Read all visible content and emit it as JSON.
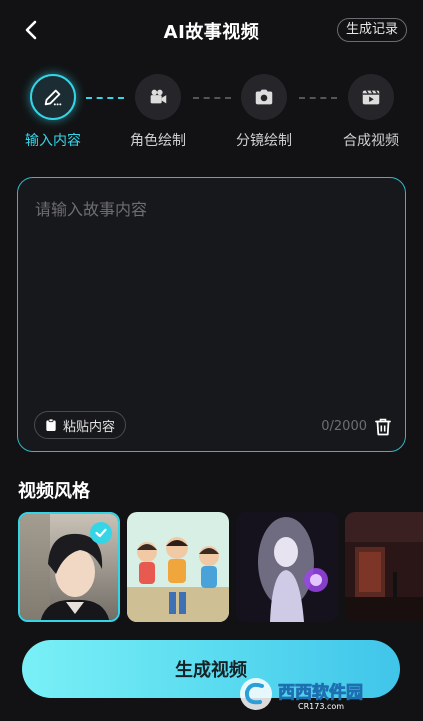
{
  "header": {
    "title": "AI故事视频",
    "records_label": "生成记录"
  },
  "steps": [
    {
      "label": "输入内容",
      "icon": "pencil-icon",
      "active": true
    },
    {
      "label": "角色绘制",
      "icon": "video-camera-icon",
      "active": false
    },
    {
      "label": "分镜绘制",
      "icon": "camera-icon",
      "active": false
    },
    {
      "label": "合成视频",
      "icon": "clapperboard-icon",
      "active": false
    }
  ],
  "story_input": {
    "placeholder": "请输入故事内容",
    "paste_label": "粘贴内容",
    "counter": "0/2000"
  },
  "video_style": {
    "title": "视频风格",
    "thumbnails": [
      {
        "name": "anime-male-portrait",
        "selected": true
      },
      {
        "name": "cartoon-children",
        "selected": false
      },
      {
        "name": "fantasy-purple-girl",
        "selected": false
      },
      {
        "name": "dark-horror-scene",
        "selected": false
      }
    ]
  },
  "generate_label": "生成视频",
  "watermark": {
    "main": "西西软件园",
    "sub": "CR173.com"
  },
  "colors": {
    "accent": "#35d5e8",
    "background": "#121214",
    "button_start": "#7af0f6",
    "button_end": "#40c5ea"
  }
}
